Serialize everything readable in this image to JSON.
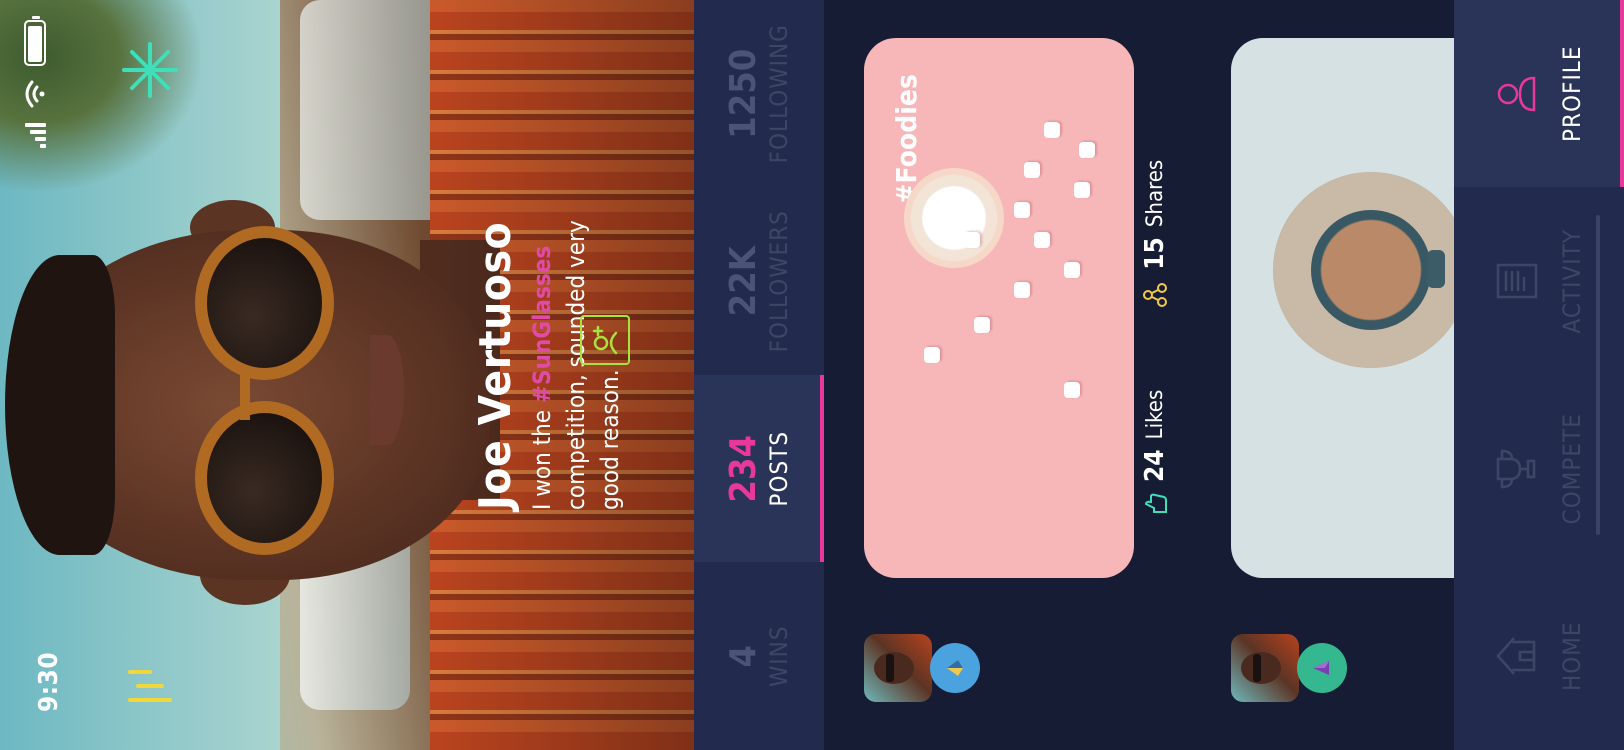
{
  "status_bar": {
    "time": "9:30"
  },
  "profile": {
    "name": "Joe Vertuoso",
    "bio_prefix": "I won the ",
    "bio_hashtag": "#SunGlasses",
    "bio_suffix": " competition, sounded very good reason."
  },
  "stats": [
    {
      "value": "4",
      "label": "WINS",
      "active": false
    },
    {
      "value": "234",
      "label": "POSTS",
      "active": true
    },
    {
      "value": "22K",
      "label": "FOLLOWERS",
      "active": false
    },
    {
      "value": "1250",
      "label": "FOLLOWING",
      "active": false
    }
  ],
  "posts": [
    {
      "hashtag": "#Foodies",
      "likes_count": "24",
      "likes_label": "Likes",
      "shares_count": "15",
      "shares_label": "Shares",
      "badge_color": "#4aa3df"
    },
    {
      "hashtag": "",
      "badge_color": "#35b890"
    }
  ],
  "nav": [
    {
      "label": "HOME",
      "icon": "home-icon",
      "active": false
    },
    {
      "label": "COMPETE",
      "icon": "trophy-icon",
      "active": false
    },
    {
      "label": "ACTIVITY",
      "icon": "activity-icon",
      "active": false
    },
    {
      "label": "PROFILE",
      "icon": "profile-icon",
      "active": true
    }
  ],
  "colors": {
    "accent": "#e8389b",
    "background": "#161c33",
    "panel": "#222a4d",
    "follow_outline": "#a8e23f",
    "spark": "#f0d83a",
    "burst": "#3de0b8"
  }
}
